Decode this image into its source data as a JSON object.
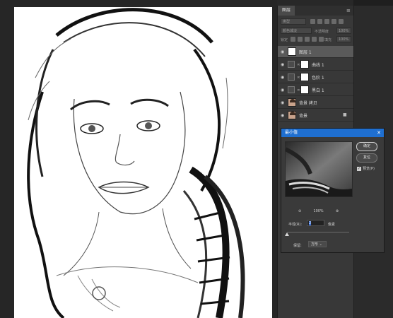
{
  "layers_panel": {
    "tab_title": "图层",
    "search_placeholder": "类型",
    "blend_mode": "颜色减淡",
    "opacity_label": "不透明度",
    "opacity_value": "100%",
    "lock_label": "锁定",
    "fill_label": "填充",
    "fill_value": "100%",
    "layers": [
      {
        "name": "图层 1"
      },
      {
        "name": "曲线 1"
      },
      {
        "name": "色阶 1"
      },
      {
        "name": "黑白 1"
      },
      {
        "name": "背景 拷贝"
      },
      {
        "name": "背景"
      }
    ]
  },
  "dialog": {
    "title": "最小值",
    "ok_label": "确定",
    "reset_label": "复位",
    "preview_label": "预览(P)",
    "preview_checked": true,
    "zoom_value": "100%",
    "radius_label": "半径(R):",
    "radius_value": "2",
    "radius_unit": "像素",
    "preserve_label": "保留:",
    "preserve_value": "方形"
  },
  "icons": [
    "eye-icon",
    "lock-icon",
    "chain-icon",
    "close-icon",
    "zoom-in-icon",
    "zoom-out-icon",
    "panel-menu-icon",
    "checkbox-icon"
  ]
}
